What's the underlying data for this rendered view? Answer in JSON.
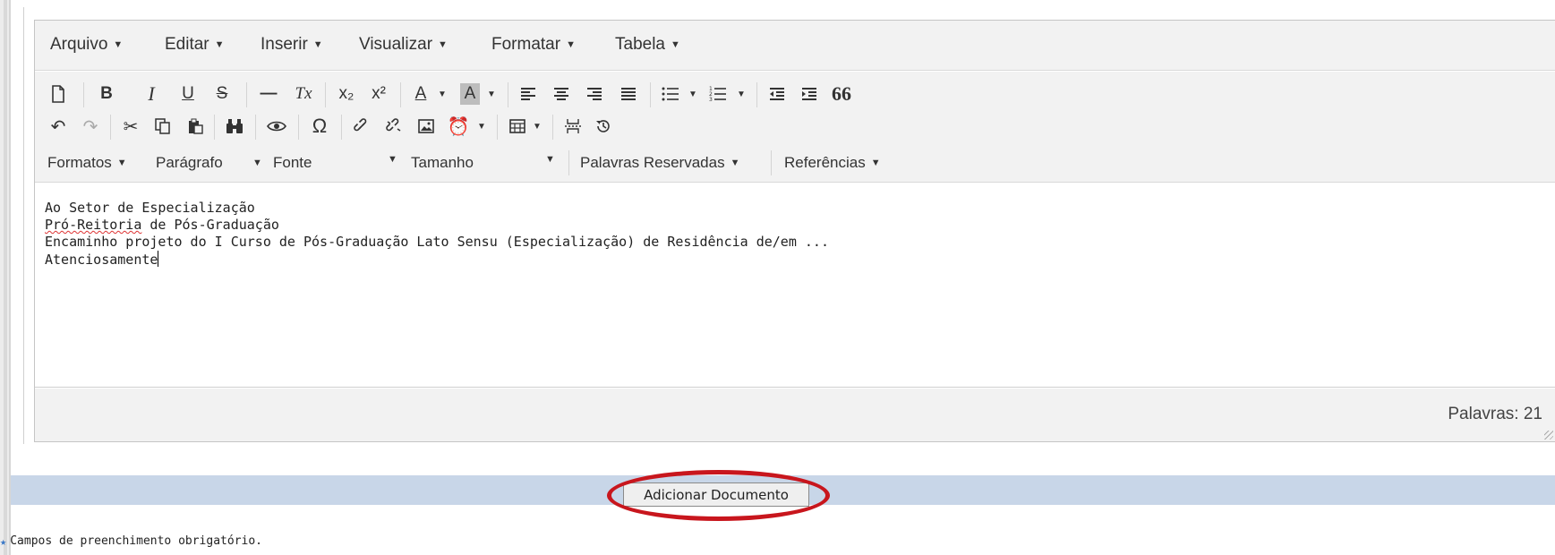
{
  "menubar": {
    "items": [
      {
        "label": "Arquivo"
      },
      {
        "label": "Editar"
      },
      {
        "label": "Inserir"
      },
      {
        "label": "Visualizar"
      },
      {
        "label": "Formatar"
      },
      {
        "label": "Tabela"
      }
    ]
  },
  "toolbar": {
    "format_row": {
      "formatos": "Formatos",
      "paragrafo": "Parágrafo",
      "fonte": "Fonte",
      "tamanho": "Tamanho",
      "palavras_reservadas": "Palavras Reservadas",
      "referencias": "Referências"
    },
    "labels": {
      "bold": "B",
      "italic": "I",
      "underline": "U",
      "strike": "S",
      "clear_format": "Tx",
      "subscript": "x₂",
      "superscript": "x²",
      "text_color": "A",
      "bg_color": "A",
      "omega": "Ω",
      "blockquote": "66"
    }
  },
  "editor": {
    "lines": [
      "Ao Setor de Especialização",
      "de Pós-Graduação",
      "",
      "",
      "Encaminho projeto do I Curso de Pós-Graduação Lato Sensu (Especialização) de Residência de/em ...",
      "",
      "",
      "Atenciosamente"
    ],
    "misspelled_word": "Pró-Reitoria",
    "word_count": "Palavras: 21"
  },
  "actions": {
    "add_document": "Adicionar Documento"
  },
  "footer": {
    "required_note": "Campos de preenchimento obrigatório."
  },
  "colors": {
    "highlight": "#c8161d",
    "actionbar": "#c8d6e8",
    "required_star": "#3a78c7"
  }
}
